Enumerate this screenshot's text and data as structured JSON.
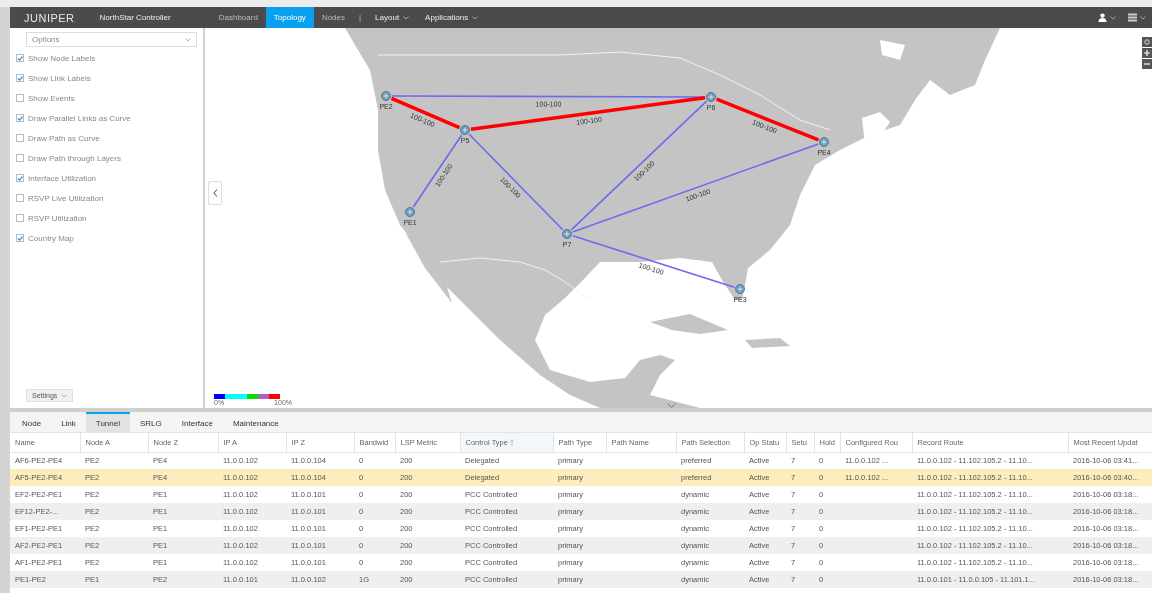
{
  "top_bar": {
    "logo": "JUNIPER",
    "title": "NorthStar Controller",
    "nav": [
      {
        "label": "Dashboard",
        "selected": false
      },
      {
        "label": "Topology",
        "selected": true
      },
      {
        "label": "Nodes",
        "selected": false
      }
    ],
    "separator": "|",
    "menus": [
      {
        "label": "Layout"
      },
      {
        "label": "Applications"
      }
    ]
  },
  "options_panel": {
    "dropdown": "Options",
    "items": [
      {
        "label": "Show Node Labels",
        "checked": true
      },
      {
        "label": "Show Link Labels",
        "checked": true
      },
      {
        "label": "Show Events",
        "checked": false
      },
      {
        "label": "Draw Parallel Links as Curve",
        "checked": true
      },
      {
        "label": "Draw Path as Curve",
        "checked": false
      },
      {
        "label": "Draw Path through Layers",
        "checked": false
      },
      {
        "label": "Interface Utilization",
        "checked": true
      },
      {
        "label": "RSVP Live Utilization",
        "checked": false
      },
      {
        "label": "RSVP Utilization",
        "checked": false
      },
      {
        "label": "Country Map",
        "checked": true
      }
    ],
    "settings_button": "Settings"
  },
  "topology": {
    "nodes": [
      {
        "label": "PE2"
      },
      {
        "label": "P5"
      },
      {
        "label": "P6"
      },
      {
        "label": "PE4"
      },
      {
        "label": "PE1"
      },
      {
        "label": "P7"
      },
      {
        "label": "PE3"
      }
    ],
    "links": [
      {
        "label": "100-100",
        "color": "#6b6bf0"
      },
      {
        "label": "100-100",
        "color": "#ff0000"
      },
      {
        "label": "100-100",
        "color": "#ff0000"
      },
      {
        "label": "100-100",
        "color": "#ff0000"
      },
      {
        "label": "100-100",
        "color": "#6b6bf0"
      },
      {
        "label": "100-100",
        "color": "#6b6bf0"
      },
      {
        "label": "100-100",
        "color": "#6b6bf0"
      },
      {
        "label": "100-100",
        "color": "#6b6bf0"
      },
      {
        "label": "100-100",
        "color": "#6b6bf0"
      }
    ],
    "legend": {
      "min_label": "0%",
      "max_label": "100%",
      "segments": [
        {
          "color": "#0000ff"
        },
        {
          "color": "#00ffff"
        },
        {
          "color": "#00e000"
        },
        {
          "color": "#b060c0"
        },
        {
          "color": "#ff0000"
        }
      ]
    }
  },
  "bottom_tabs": [
    {
      "label": "Node",
      "selected": false
    },
    {
      "label": "Link",
      "selected": false
    },
    {
      "label": "Tunnel",
      "selected": true
    },
    {
      "label": "SRLG",
      "selected": false
    },
    {
      "label": "Interface",
      "selected": false
    },
    {
      "label": "Maintenance",
      "selected": false
    }
  ],
  "table": {
    "columns": [
      {
        "label": "Name",
        "sorted": false
      },
      {
        "label": "Node A",
        "sorted": false
      },
      {
        "label": "Node Z",
        "sorted": false
      },
      {
        "label": "IP A",
        "sorted": false
      },
      {
        "label": "IP Z",
        "sorted": false
      },
      {
        "label": "Bandwid",
        "sorted": false
      },
      {
        "label": "LSP Metric",
        "sorted": false
      },
      {
        "label": "Control Type",
        "sorted": true
      },
      {
        "label": "Path Type",
        "sorted": false
      },
      {
        "label": "Path Name",
        "sorted": false
      },
      {
        "label": "Path Selection",
        "sorted": false
      },
      {
        "label": "Op Statu",
        "sorted": false
      },
      {
        "label": "Setu",
        "sorted": false
      },
      {
        "label": "Hold",
        "sorted": false
      },
      {
        "label": "Configured Rou",
        "sorted": false
      },
      {
        "label": "Record Route",
        "sorted": false
      },
      {
        "label": "Most Recent Updat",
        "sorted": false
      }
    ],
    "rows": [
      {
        "selected": false,
        "cells": [
          "AF6-PE2-PE4",
          "PE2",
          "PE4",
          "11.0.0.102",
          "11.0.0.104",
          "0",
          "200",
          "Delegated",
          "primary",
          null,
          "preferred",
          "Active",
          "7",
          "0",
          "11.0.0.102 ...",
          "11.0.0.102 - 11.102.105.2 - 11.10...",
          "2016-10-06 03:41..."
        ]
      },
      {
        "selected": true,
        "cells": [
          "AF5-PE2-PE4",
          "PE2",
          "PE4",
          "11.0.0.102",
          "11.0.0.104",
          "0",
          "200",
          "Delegated",
          "primary",
          null,
          "preferred",
          "Active",
          "7",
          "0",
          "11.0.0.102 ...",
          "11.0.0.102 - 11.102.105.2 - 11.10...",
          "2016-10-06 03:40..."
        ]
      },
      {
        "selected": false,
        "cells": [
          "EF2-PE2-PE1",
          "PE2",
          "PE1",
          "11.0.0.102",
          "11.0.0.101",
          "0",
          "200",
          "PCC Controlled",
          "primary",
          null,
          "dynamic",
          "Active",
          "7",
          "0",
          null,
          "11.0.0.102 - 11.102.105.2 - 11.10...",
          "2016-10-06 03:18..."
        ]
      },
      {
        "selected": false,
        "cells": [
          "EF12-PE2-...",
          "PE2",
          "PE1",
          "11.0.0.102",
          "11.0.0.101",
          "0",
          "200",
          "PCC Controlled",
          "primary",
          null,
          "dynamic",
          "Active",
          "7",
          "0",
          null,
          "11.0.0.102 - 11.102.105.2 - 11.10...",
          "2016-10-06 03:18..."
        ]
      },
      {
        "selected": false,
        "cells": [
          "EF1-PE2-PE1",
          "PE2",
          "PE1",
          "11.0.0.102",
          "11.0.0.101",
          "0",
          "200",
          "PCC Controlled",
          "primary",
          null,
          "dynamic",
          "Active",
          "7",
          "0",
          null,
          "11.0.0.102 - 11.102.105.2 - 11.10...",
          "2016-10-06 03:18..."
        ]
      },
      {
        "selected": false,
        "cells": [
          "AF2-PE2-PE1",
          "PE2",
          "PE1",
          "11.0.0.102",
          "11.0.0.101",
          "0",
          "200",
          "PCC Controlled",
          "primary",
          null,
          "dynamic",
          "Active",
          "7",
          "0",
          null,
          "11.0.0.102 - 11.102.105.2 - 11.10...",
          "2016-10-06 03:18..."
        ]
      },
      {
        "selected": false,
        "cells": [
          "AF1-PE2-PE1",
          "PE2",
          "PE1",
          "11.0.0.102",
          "11.0.0.101",
          "0",
          "200",
          "PCC Controlled",
          "primary",
          null,
          "dynamic",
          "Active",
          "7",
          "0",
          null,
          "11.0.0.102 - 11.102.105.2 - 11.10...",
          "2016-10-06 03:18..."
        ]
      },
      {
        "selected": false,
        "cells": [
          "PE1-PE2",
          "PE1",
          "PE2",
          "11.0.0.101",
          "11.0.0.102",
          "1G",
          "200",
          "PCC Controlled",
          "primary",
          null,
          "dynamic",
          "Active",
          "7",
          "0",
          null,
          "11.0.0.101 - 11.0.0.105 - 11.101.1...",
          "2016-10-06 03:18..."
        ]
      }
    ]
  }
}
